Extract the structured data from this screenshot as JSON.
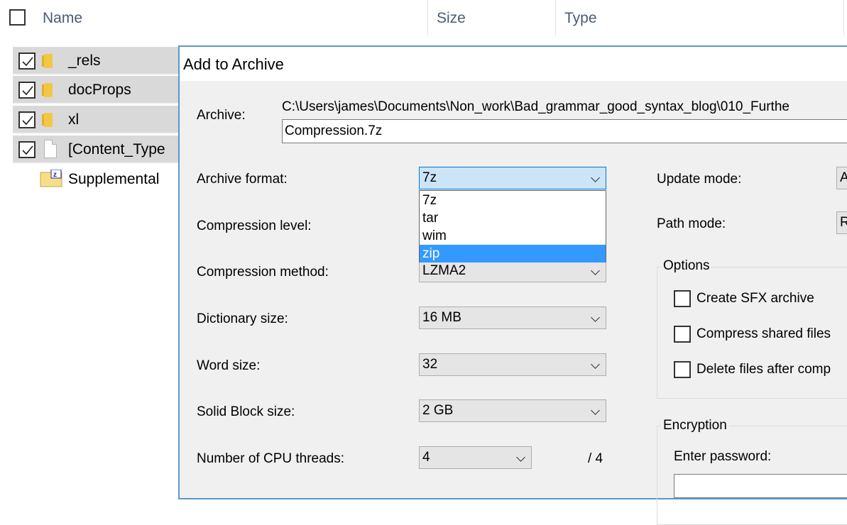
{
  "explorer": {
    "columns": [
      "Name",
      "Size",
      "Type"
    ],
    "rows": [
      {
        "name": "_rels",
        "type": "folder",
        "checked": true
      },
      {
        "name": "docProps",
        "type": "folder",
        "checked": true
      },
      {
        "name": "xl",
        "type": "folder",
        "checked": true
      },
      {
        "name": "[Content_Type",
        "type": "file",
        "checked": true
      },
      {
        "name": "Supplemental",
        "type": "archive",
        "checked": false
      }
    ]
  },
  "dialog": {
    "title": "Add to Archive",
    "archive_label": "Archive:",
    "archive_path": "C:\\Users\\james\\Documents\\Non_work\\Bad_grammar_good_syntax_blog\\010_Furthe",
    "archive_name": "Compression.7z",
    "archive_format_label": "Archive format:",
    "archive_format_value": "7z",
    "format_options": [
      "7z",
      "tar",
      "wim",
      "zip"
    ],
    "format_highlighted": "zip",
    "compression_level_label": "Compression level:",
    "compression_method_label": "Compression method:",
    "compression_method_value": "LZMA2",
    "dictionary_size_label": "Dictionary size:",
    "dictionary_size_value": "16 MB",
    "word_size_label": "Word size:",
    "word_size_value": "32",
    "solid_block_label": "Solid Block size:",
    "solid_block_value": "2 GB",
    "cpu_threads_label": "Number of CPU threads:",
    "cpu_threads_value": "4",
    "cpu_threads_max": "/ 4",
    "update_mode_label": "Update mode:",
    "update_mode_value": "A",
    "path_mode_label": "Path mode:",
    "path_mode_value": "R",
    "options_title": "Options",
    "opt_sfx": "Create SFX archive",
    "opt_shared": "Compress shared files",
    "opt_delete": "Delete files after comp",
    "encryption_title": "Encryption",
    "password_label": "Enter password:"
  }
}
